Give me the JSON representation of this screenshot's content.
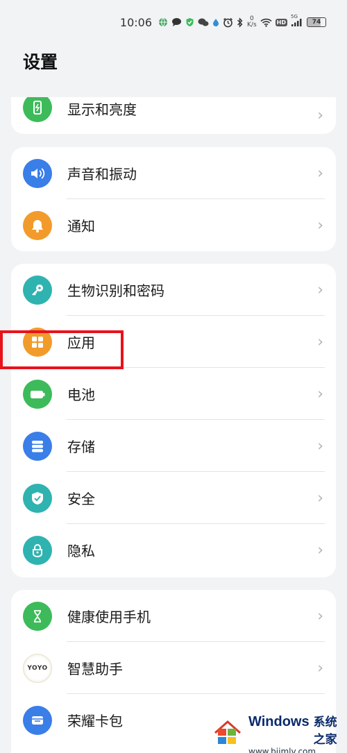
{
  "status_bar": {
    "time": "10:06",
    "net_speed_value": "0",
    "net_speed_unit": "K/s",
    "hd_label": "HD",
    "signal_label": "5G",
    "battery": "74"
  },
  "page_title": "设置",
  "sections": {
    "display": {
      "label": "显示和亮度",
      "icon": "display-brightness-icon",
      "color": "#3dbb5a"
    },
    "sound": {
      "label": "声音和振动",
      "icon": "speaker-icon",
      "color": "#3a7ee8"
    },
    "notify": {
      "label": "通知",
      "icon": "bell-icon",
      "color": "#f29b2a"
    },
    "biometric": {
      "label": "生物识别和密码",
      "icon": "key-icon",
      "color": "#2fb3b0"
    },
    "apps": {
      "label": "应用",
      "icon": "apps-grid-icon",
      "color": "#f29b2a"
    },
    "battery": {
      "label": "电池",
      "icon": "battery-icon",
      "color": "#3dbb5a"
    },
    "storage": {
      "label": "存储",
      "icon": "storage-icon",
      "color": "#3a7ee8"
    },
    "security": {
      "label": "安全",
      "icon": "shield-check-icon",
      "color": "#2fb3b0"
    },
    "privacy": {
      "label": "隐私",
      "icon": "privacy-lock-icon",
      "color": "#2fb3b0"
    },
    "digital_health": {
      "label": "健康使用手机",
      "icon": "hourglass-icon",
      "color": "#3dbb5a"
    },
    "assistant": {
      "label": "智慧助手",
      "icon": "yoyo-icon",
      "badge_text": "YOYO"
    },
    "wallet": {
      "label": "荣耀卡包",
      "icon": "wallet-icon",
      "color": "#3a7ee8"
    }
  },
  "chevron": "›",
  "watermark": {
    "brand": "Windows",
    "brand_cn": "系统之家",
    "url": "www.bjjmlv.com"
  }
}
